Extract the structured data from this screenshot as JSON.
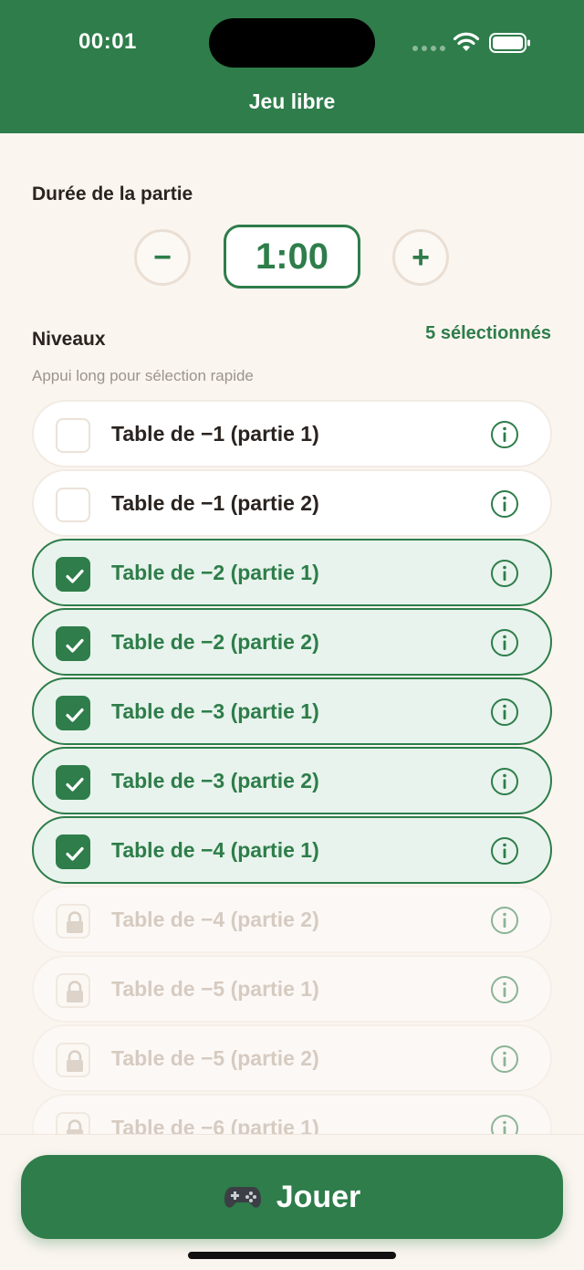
{
  "status_bar": {
    "time": "00:01"
  },
  "header": {
    "title": "Jeu libre"
  },
  "duration": {
    "title": "Durée de la partie",
    "value": "1:00",
    "decrement_label": "−",
    "increment_label": "+"
  },
  "levels": {
    "title": "Niveaux",
    "selected_count": "5 sélectionnés",
    "hint": "Appui long pour sélection rapide",
    "items": [
      {
        "label": "Table de −1 (partie 1)",
        "state": "unchecked"
      },
      {
        "label": "Table de −1 (partie 2)",
        "state": "unchecked"
      },
      {
        "label": "Table de −2 (partie 1)",
        "state": "checked"
      },
      {
        "label": "Table de −2 (partie 2)",
        "state": "checked"
      },
      {
        "label": "Table de −3 (partie 1)",
        "state": "checked"
      },
      {
        "label": "Table de −3 (partie 2)",
        "state": "checked"
      },
      {
        "label": "Table de −4 (partie 1)",
        "state": "checked"
      },
      {
        "label": "Table de −4 (partie 2)",
        "state": "locked"
      },
      {
        "label": "Table de −5 (partie 1)",
        "state": "locked"
      },
      {
        "label": "Table de −5 (partie 2)",
        "state": "locked"
      },
      {
        "label": "Table de −6 (partie 1)",
        "state": "locked"
      }
    ]
  },
  "play_button": {
    "label": "Jouer",
    "icon": "gamepad-icon"
  },
  "colors": {
    "primary": "#2e7d4a",
    "background": "#fbf5f0",
    "checked_row": "#e7f3ec"
  }
}
